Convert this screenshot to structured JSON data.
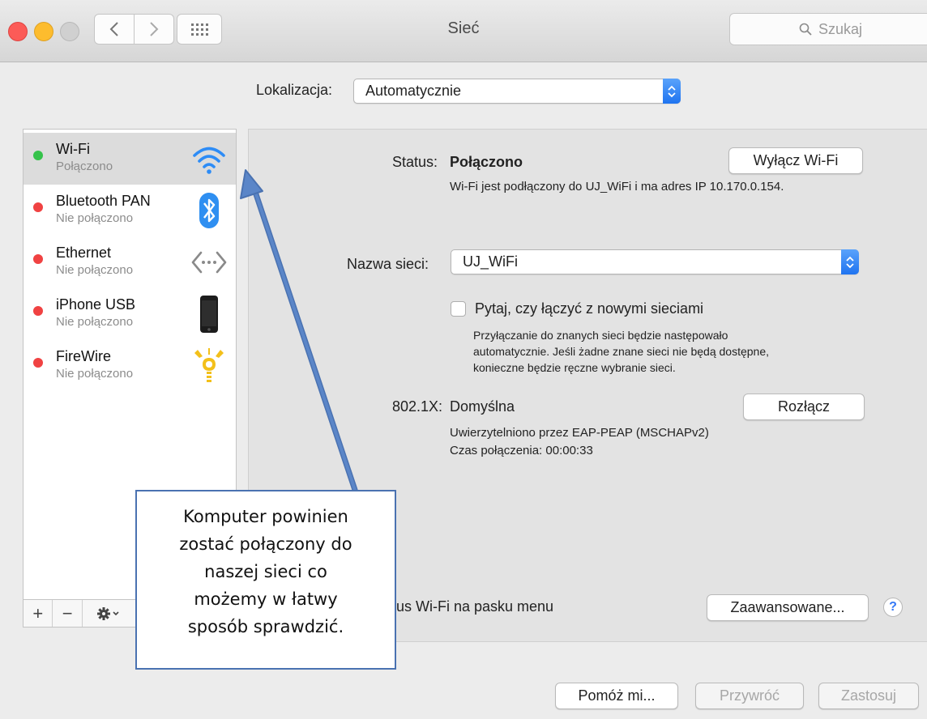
{
  "window": {
    "title": "Sieć",
    "search_placeholder": "Szukaj"
  },
  "location": {
    "label": "Lokalizacja:",
    "value": "Automatycznie"
  },
  "services": [
    {
      "name": "Wi-Fi",
      "status": "Połączono",
      "status_color": "#35c24a",
      "icon": "wifi-icon",
      "selected": true
    },
    {
      "name": "Bluetooth PAN",
      "status": "Nie połączono",
      "status_color": "#f04242",
      "icon": "bluetooth-icon"
    },
    {
      "name": "Ethernet",
      "status": "Nie połączono",
      "status_color": "#f04242",
      "icon": "ethernet-icon"
    },
    {
      "name": "iPhone USB",
      "status": "Nie połączono",
      "status_color": "#f04242",
      "icon": "iphone-icon"
    },
    {
      "name": "FireWire",
      "status": "Nie połączono",
      "status_color": "#f04242",
      "icon": "firewire-icon"
    }
  ],
  "sidebar_actions": {
    "add": "+",
    "remove": "−"
  },
  "detail": {
    "status_label": "Status:",
    "status_value": "Połączono",
    "turn_off_button": "Wyłącz Wi-Fi",
    "status_description": "Wi-Fi jest podłączony do UJ_WiFi i ma adres IP 10.170.0.154.",
    "network_name_label": "Nazwa sieci:",
    "network_name_value": "UJ_WiFi",
    "ask_join_label": "Pytaj, czy łączyć z nowymi sieciami",
    "ask_join_checked": false,
    "ask_join_help": [
      "Przyłączanie do znanych sieci będzie następowało",
      "automatycznie. Jeśli żadne znane sieci nie będą dostępne,",
      "konieczne będzie ręczne wybranie sieci."
    ],
    "dot1x_label": "802.1X:",
    "dot1x_value": "Domyślna",
    "disconnect_button": "Rozłącz",
    "auth_info": "Uwierzytelniono przez EAP-PEAP (MSCHAPv2)",
    "connection_time": "Czas połączenia: 00:00:33",
    "menubar_status_partial": "us Wi-Fi na pasku menu",
    "advanced_button": "Zaawansowane...",
    "help_button": "?"
  },
  "footer": {
    "assist_button": "Pomóż mi...",
    "revert_button": "Przywróć",
    "apply_button": "Zastosuj"
  },
  "annotation": {
    "lines": [
      "Komputer powinien",
      "zostać połączony do",
      "naszej sieci co",
      "możemy w łatwy",
      "sposób sprawdzić."
    ],
    "color": "#4a72b1"
  }
}
